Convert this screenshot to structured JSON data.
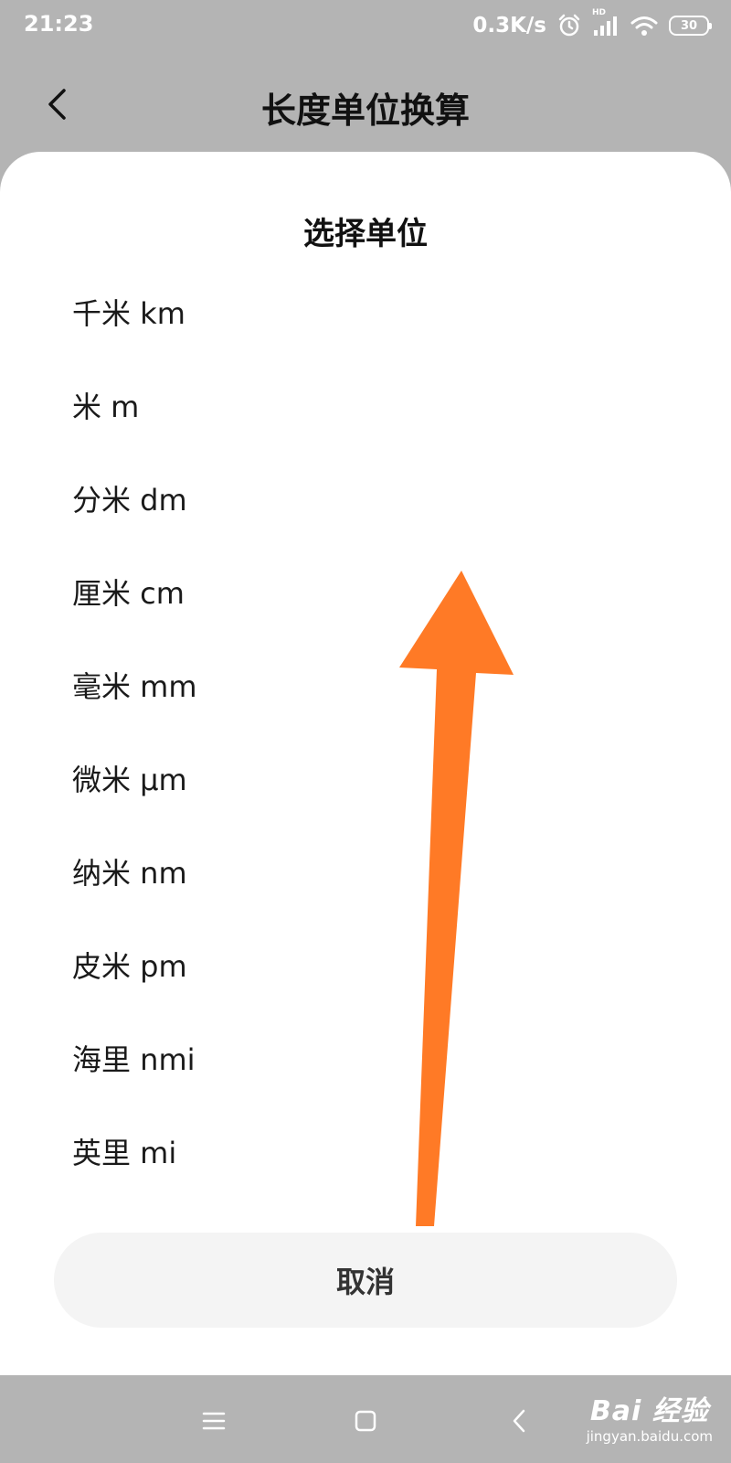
{
  "status_bar": {
    "time": "21:23",
    "network_speed": "0.3K/s",
    "signal_label": "HD",
    "battery": "30",
    "icons": [
      "alarm-icon",
      "signal-icon",
      "wifi-icon",
      "battery-icon"
    ]
  },
  "header": {
    "title": "长度单位换算",
    "back_icon": "chevron-left-icon"
  },
  "sheet": {
    "title": "选择单位",
    "units": [
      {
        "label": "千米 km"
      },
      {
        "label": "米 m"
      },
      {
        "label": "分米 dm"
      },
      {
        "label": "厘米 cm"
      },
      {
        "label": "毫米 mm"
      },
      {
        "label": "微米 μm"
      },
      {
        "label": "纳米 nm"
      },
      {
        "label": "皮米 pm"
      },
      {
        "label": "海里 nmi"
      },
      {
        "label": "英里 mi"
      }
    ],
    "cancel_label": "取消"
  },
  "annotation": {
    "arrow_color": "#ff7a26",
    "arrow_meaning": "swipe-up"
  },
  "nav_bar": {
    "icons": [
      "menu-icon",
      "home-icon",
      "back-icon"
    ]
  },
  "watermark": {
    "logo": "Bai 经验",
    "url": "jingyan.baidu.com"
  },
  "colors": {
    "scrim": "#b4b4b4",
    "sheet": "#ffffff",
    "cancel_bg": "#f4f4f4"
  }
}
